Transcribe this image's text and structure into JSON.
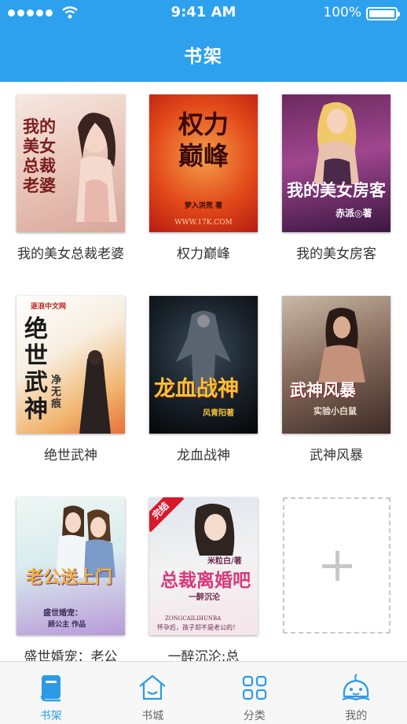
{
  "status_bar": {
    "time": "9:41 AM",
    "battery": "100%"
  },
  "header": {
    "title": "书架"
  },
  "books": [
    {
      "title": "我的美女总裁老婆",
      "cover_text": "我的美女总裁老婆"
    },
    {
      "title": "权力巅峰",
      "cover_text": "权力巅峰",
      "cover_author": "梦入洪荒 著",
      "cover_url": "WWW.17K.COM"
    },
    {
      "title": "我的美女房客",
      "cover_text": "我的美女房客",
      "cover_author": "赤派◎著"
    },
    {
      "title": "绝世武神",
      "cover_text": "绝世武神",
      "cover_author": "净无痕",
      "cover_site": "逐浪中文网"
    },
    {
      "title": "龙血战神",
      "cover_text": "龙血战神",
      "cover_author": "风青阳著"
    },
    {
      "title": "武神风暴",
      "cover_text": "武神风暴",
      "cover_author": "实验小白鼠"
    },
    {
      "title": "盛世婚宠：老公",
      "cover_text": "老公送上门",
      "cover_sub": "盛世婚宠：",
      "cover_author": "顾公主 作品"
    },
    {
      "title": "一醉沉沦:总",
      "cover_text": "总裁离婚吧",
      "cover_badge": "完结",
      "cover_author": "米粒白/著",
      "cover_sub": "一醉沉沦",
      "cover_pinyin": "ZONGCAILIHUNBA",
      "cover_tag": "怀孕后，孩子却不是老公的！"
    }
  ],
  "add_book": {
    "icon": "plus-icon"
  },
  "tabbar": {
    "items": [
      {
        "label": "书架",
        "icon": "bookshelf-icon",
        "active": true
      },
      {
        "label": "书城",
        "icon": "house-icon",
        "active": false
      },
      {
        "label": "分类",
        "icon": "grid-icon",
        "active": false
      },
      {
        "label": "我的",
        "icon": "profile-face-icon",
        "active": false
      }
    ]
  },
  "colors": {
    "header": "#2da0ee",
    "tab_active": "#2c9be6",
    "tab_inactive": "#666666"
  }
}
